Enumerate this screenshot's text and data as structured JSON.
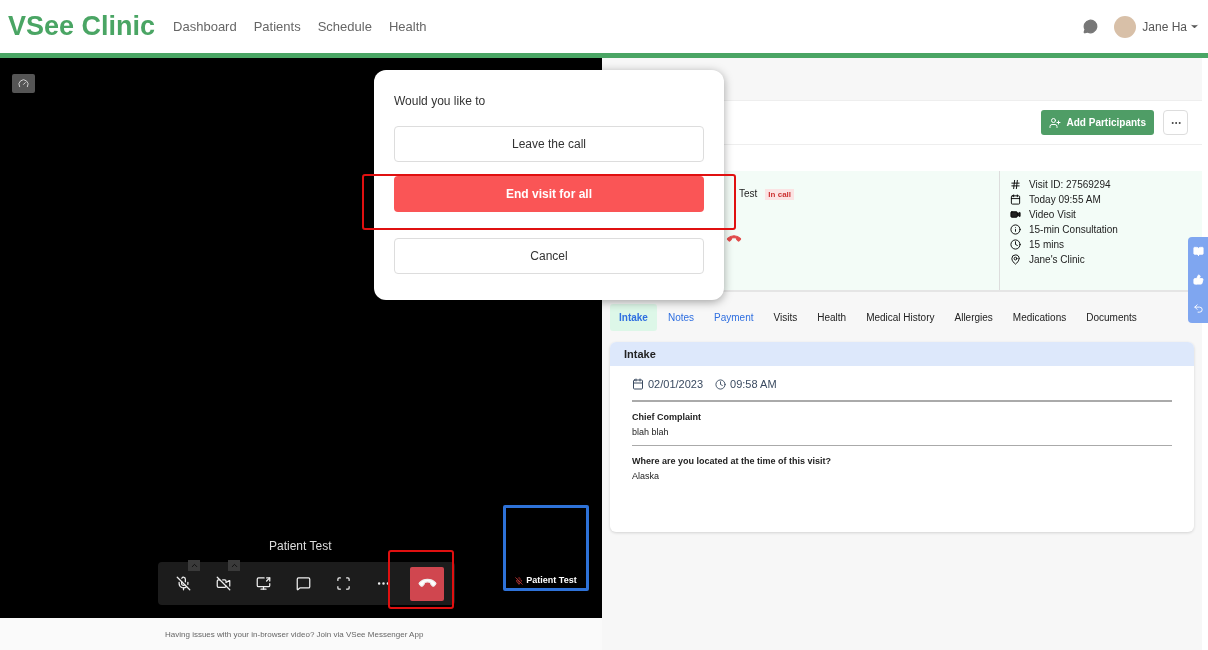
{
  "header": {
    "logo": "VSee Clinic",
    "nav": [
      {
        "label": "Dashboard"
      },
      {
        "label": "Patients"
      },
      {
        "label": "Schedule"
      },
      {
        "label": "Health"
      }
    ],
    "user": "Jane Ha"
  },
  "video": {
    "caller": "Patient Test",
    "self_label": "Patient Test",
    "controls": [
      {
        "kind": "mic",
        "has_menu": true
      },
      {
        "kind": "camera",
        "has_menu": true
      },
      {
        "kind": "share",
        "has_menu": false
      },
      {
        "kind": "chat",
        "has_menu": false
      },
      {
        "kind": "fullscreen",
        "has_menu": false
      },
      {
        "kind": "more",
        "has_menu": false
      },
      {
        "kind": "hangup",
        "has_menu": false
      }
    ]
  },
  "footer": "Having issues with your in-browser video? Join via VSee Messenger App",
  "dialog": {
    "prompt": "Would you like to",
    "buttons": [
      {
        "label": "Leave the call",
        "kind": "plain"
      },
      {
        "label": "End visit for all",
        "kind": "danger"
      },
      {
        "label": "Cancel",
        "kind": "plain"
      }
    ]
  },
  "visit": {
    "add_button": "Add Participants",
    "patient": "Test",
    "status": "In call",
    "info": [
      {
        "kind": "id",
        "text": "Visit ID: 27569294"
      },
      {
        "kind": "date",
        "text": "Today 09:55 AM"
      },
      {
        "kind": "video",
        "text": "Video Visit"
      },
      {
        "kind": "info",
        "text": "15-min Consultation"
      },
      {
        "kind": "duration",
        "text": "15 mins"
      },
      {
        "kind": "place",
        "text": "Jane's Clinic"
      }
    ]
  },
  "tabs": [
    {
      "label": "Intake",
      "selected": true,
      "kind": "link"
    },
    {
      "label": "Notes",
      "selected": false,
      "kind": "link"
    },
    {
      "label": "Payment",
      "selected": false,
      "kind": "link"
    },
    {
      "label": "Visits",
      "selected": false,
      "kind": "plain"
    },
    {
      "label": "Health",
      "selected": false,
      "kind": "plain"
    },
    {
      "label": "Medical History",
      "selected": false,
      "kind": "plain"
    },
    {
      "label": "Allergies",
      "selected": false,
      "kind": "plain"
    },
    {
      "label": "Medications",
      "selected": false,
      "kind": "plain"
    },
    {
      "label": "Documents",
      "selected": false,
      "kind": "plain"
    }
  ],
  "intake": {
    "title": "Intake",
    "date": "02/01/2023",
    "time": "09:58 AM",
    "fields": [
      {
        "label": "Chief Complaint",
        "value": "blah blah"
      },
      {
        "label": "Where are you located at the time of this visit?",
        "value": "Alaska"
      }
    ]
  }
}
